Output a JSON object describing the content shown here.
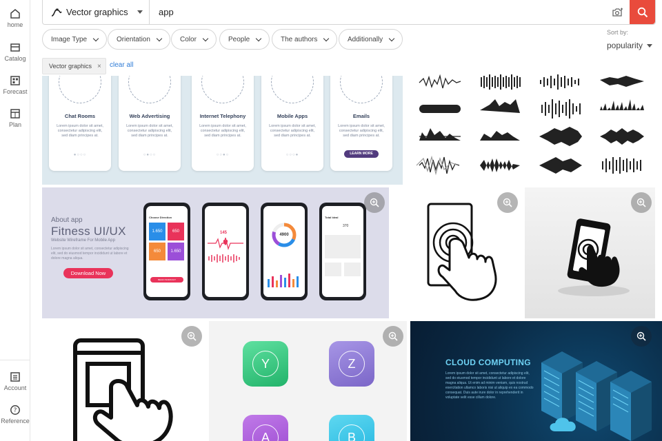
{
  "sidebar": {
    "items": [
      {
        "label": "home",
        "icon": "home-icon"
      },
      {
        "label": "Catalog",
        "icon": "catalog-icon"
      },
      {
        "label": "Forecast",
        "icon": "forecast-icon"
      },
      {
        "label": "Plan",
        "icon": "plan-icon"
      }
    ],
    "bottom": [
      {
        "label": "Account",
        "icon": "account-icon"
      },
      {
        "label": "Reference",
        "icon": "help-icon"
      }
    ]
  },
  "search": {
    "type_label": "Vector graphics",
    "query": "app"
  },
  "filters": [
    "Image Type",
    "Orientation",
    "Color",
    "People",
    "The authors",
    "Additionally"
  ],
  "sort": {
    "label": "Sort by:",
    "value": "popularity"
  },
  "active_filter": {
    "label": "Vector graphics",
    "clear_label": "clear all"
  },
  "results": {
    "onboarding": {
      "cards": [
        {
          "title": "Chat Rooms",
          "text": "Lorem ipsum dolor sit amet, consectetur adipiscing elit, sed diam principes at."
        },
        {
          "title": "Web Advertising",
          "text": "Lorem ipsum dolor sit amet, consectetur adipiscing elit, sed diam principes at."
        },
        {
          "title": "Internet Telephony",
          "text": "Lorem ipsum dolor sit amet, consectetur adipiscing elit, sed diam principes at."
        },
        {
          "title": "Mobile Apps",
          "text": "Lorem ipsum dolor sit amet, consectetur adipiscing elit, sed diam principes at."
        },
        {
          "title": "Emails",
          "text": "Lorem ipsum dolor sit amet, consectetur adipiscing elit, sed diam principes at."
        }
      ],
      "button": "LEARN MORE"
    },
    "fitness": {
      "kicker": "About app",
      "title": "Fitness UI/UX",
      "subtitle": "Website Wireframe For Mobile App",
      "text": "Lorem ipsum dolor sit amet, consectetur adipiscing elit, sed do eiusmod tempor incididunt ut labore et dolore magna aliqua.",
      "button": "Download Now",
      "screen1_header": "Choose Direction",
      "tiles": [
        "1.650",
        "650",
        "650",
        "1.650"
      ],
      "workout_button": "BEGIN WORKOUT",
      "bpm": "145",
      "ring_value": "4900",
      "total_label": "Total Ideal",
      "total_value": "370"
    },
    "app_letters": [
      "Y",
      "Z",
      "A",
      "B"
    ],
    "cloud": {
      "title": "CLOUD COMPUTING",
      "text": "Lorem ipsum dolor sit amet, consectetur adipiscing elit, sed do eiusmod tempor incididunt ut labore et dolore magna aliqua. Ut enim ad minim veniam, quis nostrud exercitation ullamco laboris nisi ut aliquip ex ea commodo consequat. Duis aute irure dolor in reprehenderit in voluptate velit esse cillum dolore."
    }
  },
  "colors": {
    "accent": "#e94b3c",
    "link": "#2e7bd6",
    "fitness_pink": "#e9335a",
    "cloud_bg": "#0a2a45"
  }
}
